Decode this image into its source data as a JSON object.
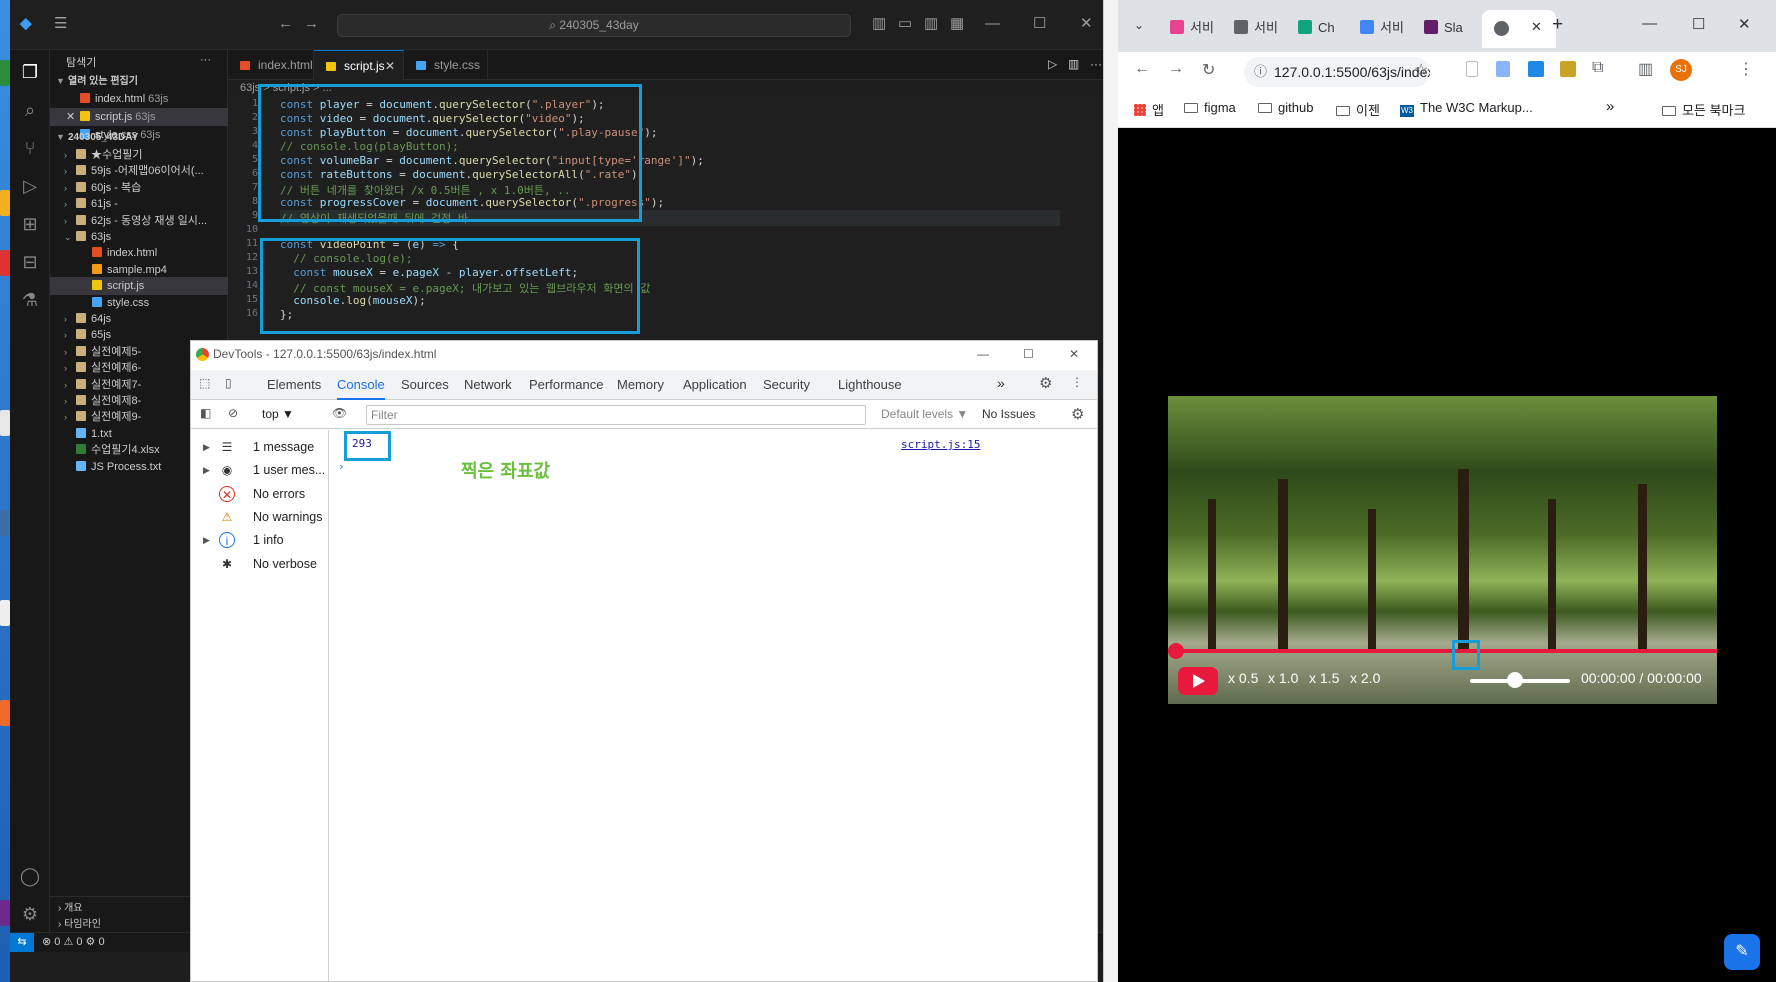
{
  "vscode": {
    "title_search": "240305_43day",
    "sidebar_title": "탐색기",
    "open_editors_label": "열려 있는 편집기",
    "open_editors": [
      {
        "name": "index.html",
        "badge": "63js",
        "type": "html"
      },
      {
        "name": "script.js",
        "badge": "63js",
        "type": "js"
      },
      {
        "name": "style.css",
        "badge": "63js",
        "type": "css"
      }
    ],
    "workspace_label": "240305_43DAY",
    "tree": [
      {
        "name": "★수업필기",
        "kind": "folder"
      },
      {
        "name": "59js -어제맵06이어서(...",
        "kind": "folder"
      },
      {
        "name": "60js - 복습",
        "kind": "folder"
      },
      {
        "name": "61js -",
        "kind": "folder"
      },
      {
        "name": "62js - 동영상 재생 일시...",
        "kind": "folder"
      },
      {
        "name": "63js",
        "kind": "folder-open"
      },
      {
        "name": "index.html",
        "kind": "html"
      },
      {
        "name": "sample.mp4",
        "kind": "mp4"
      },
      {
        "name": "script.js",
        "kind": "js"
      },
      {
        "name": "style.css",
        "kind": "css"
      },
      {
        "name": "64js",
        "kind": "folder"
      },
      {
        "name": "65js",
        "kind": "folder"
      },
      {
        "name": "실전예제5-",
        "kind": "folder"
      },
      {
        "name": "실전예제6-",
        "kind": "folder"
      },
      {
        "name": "실전예제7-",
        "kind": "folder"
      },
      {
        "name": "실전예제8-",
        "kind": "folder"
      },
      {
        "name": "실전예제9-",
        "kind": "folder"
      },
      {
        "name": "1.txt",
        "kind": "txt"
      },
      {
        "name": "수업필기4.xlsx",
        "kind": "xlsx"
      },
      {
        "name": "JS Process.txt",
        "kind": "txt"
      }
    ],
    "outline_label": "개요",
    "timeline_label": "타임라인",
    "tabs": [
      "index.html",
      "script.js",
      "style.css"
    ],
    "breadcrumb": "63js  >  script.js  >  ...",
    "line_numbers": [
      "1",
      "2",
      "3",
      "4",
      "5",
      "6",
      "7",
      "8",
      "9",
      "10",
      "11",
      "12",
      "13",
      "14",
      "15",
      "16"
    ],
    "status_left": "⊗ 0 ⚠ 0   ⚙ 0"
  },
  "devtools": {
    "title": "DevTools - 127.0.0.1:5500/63js/index.html",
    "tabs": [
      "Elements",
      "Console",
      "Sources",
      "Network",
      "Performance",
      "Memory",
      "Application",
      "Security",
      "Lighthouse"
    ],
    "context": "top",
    "filter_placeholder": "Filter",
    "levels": "Default levels ▼",
    "issues": "No Issues",
    "sidebar": [
      {
        "label": "1 message",
        "icon": "list"
      },
      {
        "label": "1 user mes...",
        "icon": "user"
      },
      {
        "label": "No errors",
        "icon": "error"
      },
      {
        "label": "No warnings",
        "icon": "warning"
      },
      {
        "label": "1 info",
        "icon": "info"
      },
      {
        "label": "No verbose",
        "icon": "bug"
      }
    ],
    "log_value": "293",
    "log_source": "script.js:15",
    "annotation": "찍은 좌표값"
  },
  "chrome": {
    "tabs": [
      "서비",
      "서비",
      "Ch",
      "서비",
      "Sla"
    ],
    "url": "127.0.0.1:5500/63js/index.html",
    "avatar": "SJ",
    "bookmarks": [
      "앱",
      "figma",
      "github",
      "이젠",
      "The W3C Markup...",
      "모든 북마크"
    ],
    "player": {
      "rates": [
        "x 0.5",
        "x 1.0",
        "x 1.5",
        "x 2.0"
      ],
      "current_time": "00:00:00",
      "separator": "/",
      "duration": "00:00:00",
      "volume_level": 0.45,
      "progress_level": 1.0
    }
  }
}
